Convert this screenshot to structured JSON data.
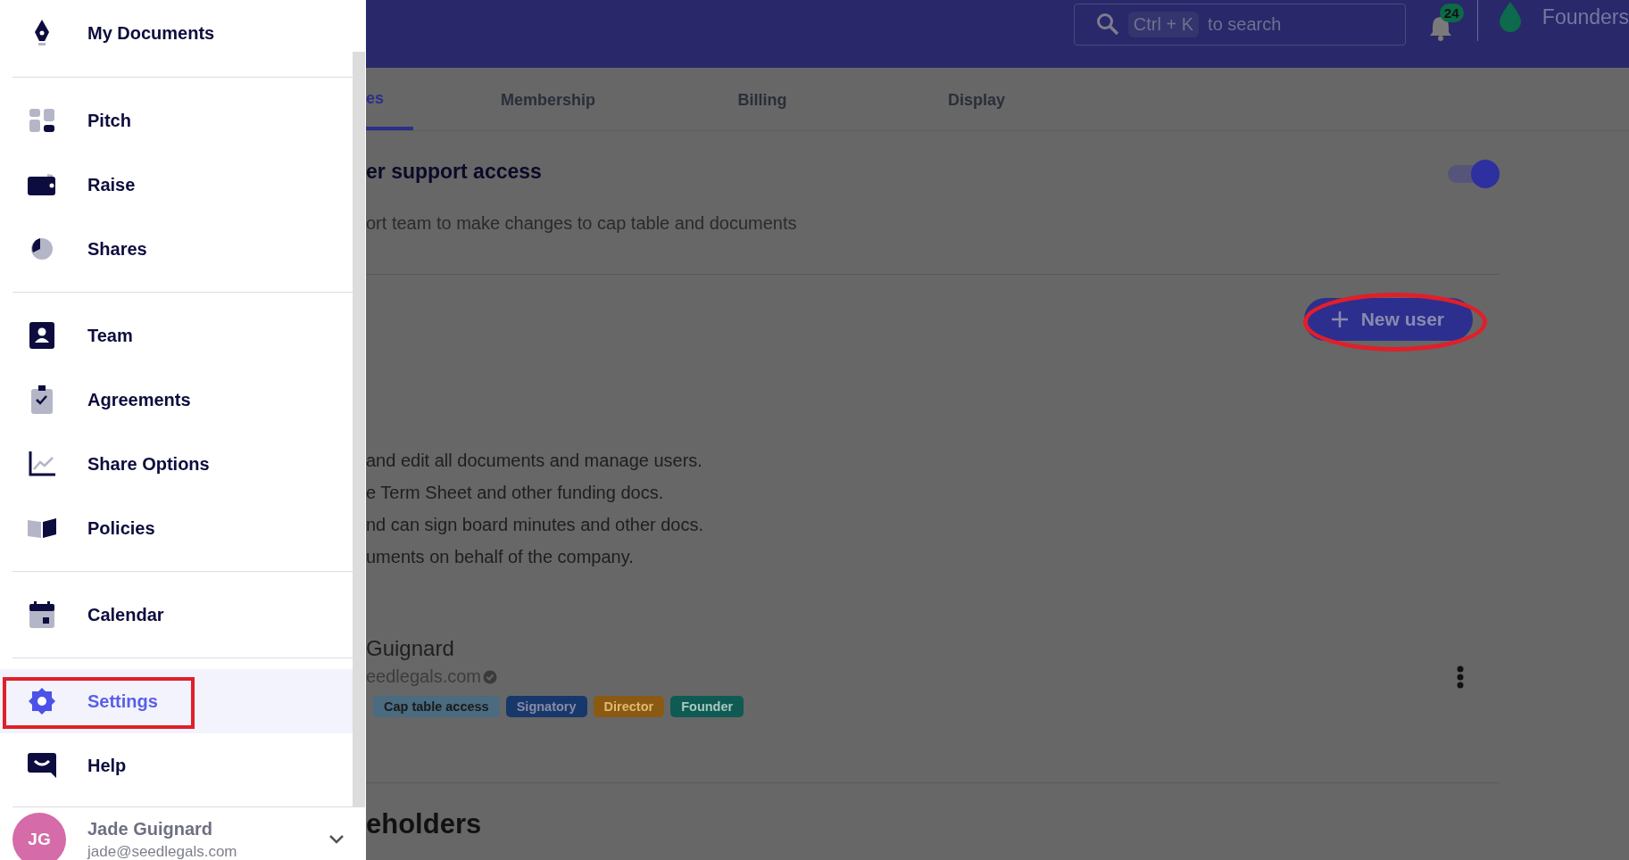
{
  "sidebar": {
    "groups": [
      {
        "items": [
          {
            "label": "My Documents",
            "selected": false
          }
        ]
      },
      {
        "items": [
          {
            "label": "Pitch",
            "selected": false
          },
          {
            "label": "Raise",
            "selected": false
          },
          {
            "label": "Shares",
            "selected": false
          }
        ]
      },
      {
        "items": [
          {
            "label": "Team",
            "selected": false
          },
          {
            "label": "Agreements",
            "selected": false
          },
          {
            "label": "Share Options",
            "selected": false
          },
          {
            "label": "Policies",
            "selected": false
          }
        ]
      },
      {
        "items": [
          {
            "label": "Calendar",
            "selected": false
          }
        ]
      },
      {
        "items": [
          {
            "label": "Settings",
            "selected": true
          },
          {
            "label": "Help",
            "selected": false
          }
        ]
      }
    ],
    "user": {
      "initials": "JG",
      "name": "Jade Guignard",
      "email": "jade@seedlegals.com"
    }
  },
  "top_bar": {
    "search": {
      "shortcut": "Ctrl + K",
      "placeholder": "to search"
    },
    "notifications": "24",
    "account": "Founders"
  },
  "tabs": [
    {
      "label": "es",
      "selected": true
    },
    {
      "label": "Membership",
      "selected": false
    },
    {
      "label": "Billing",
      "selected": false
    },
    {
      "label": "Display",
      "selected": false
    }
  ],
  "support": {
    "title": "er support access",
    "description": "ort team to make changes to cap table and documents",
    "on": true
  },
  "new_user_button": "New user",
  "role_descriptions": [
    "and edit all documents and manage users.",
    "e Term Sheet and other funding docs.",
    "nd can sign board minutes and other docs.",
    "uments on behalf of the company."
  ],
  "user_row": {
    "name": "Guignard",
    "email": "eedlegals.com",
    "verified": true,
    "tags": [
      {
        "label": "Cap table access",
        "color": "#4a6b80"
      },
      {
        "label": "Signatory",
        "color": "#17386b"
      },
      {
        "label": "Director",
        "color": "#8a5a12"
      },
      {
        "label": "Founder",
        "color": "#0f5a52"
      }
    ]
  },
  "next_section": "eholders"
}
